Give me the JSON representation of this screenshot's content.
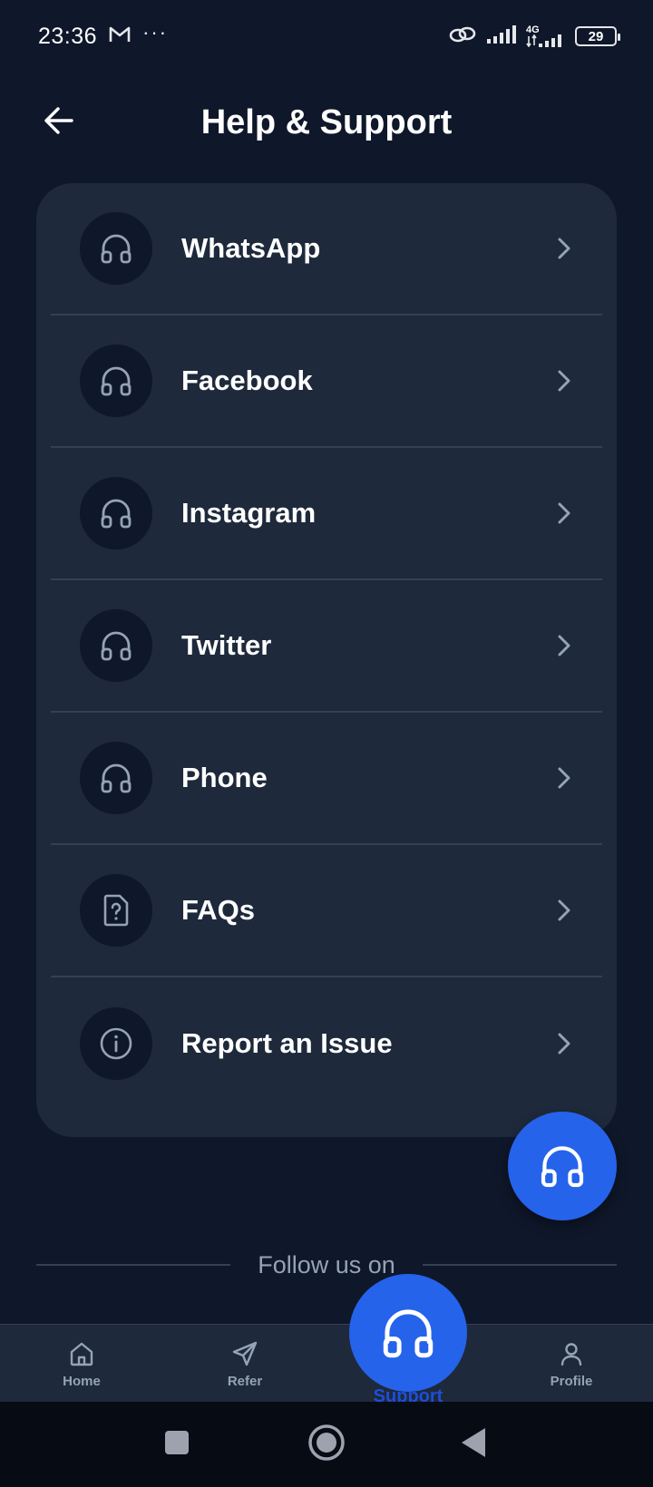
{
  "status_bar": {
    "time": "23:36",
    "dots": "···",
    "network": "4G",
    "battery": "29"
  },
  "header": {
    "title": "Help & Support"
  },
  "support_items": [
    {
      "label": "WhatsApp",
      "icon": "headphones-icon"
    },
    {
      "label": "Facebook",
      "icon": "headphones-icon"
    },
    {
      "label": "Instagram",
      "icon": "headphones-icon"
    },
    {
      "label": "Twitter",
      "icon": "headphones-icon"
    },
    {
      "label": "Phone",
      "icon": "headphones-icon"
    },
    {
      "label": "FAQs",
      "icon": "faq-document-icon"
    },
    {
      "label": "Report an Issue",
      "icon": "info-icon"
    }
  ],
  "follow": {
    "text": "Follow us on"
  },
  "bottom_nav": {
    "home": "Home",
    "refer": "Refer",
    "support": "Support",
    "profile": "Profile"
  },
  "colors": {
    "background": "#0f172a",
    "card": "#1e293b",
    "accent": "#2563eb",
    "muted": "#94a3b8"
  }
}
